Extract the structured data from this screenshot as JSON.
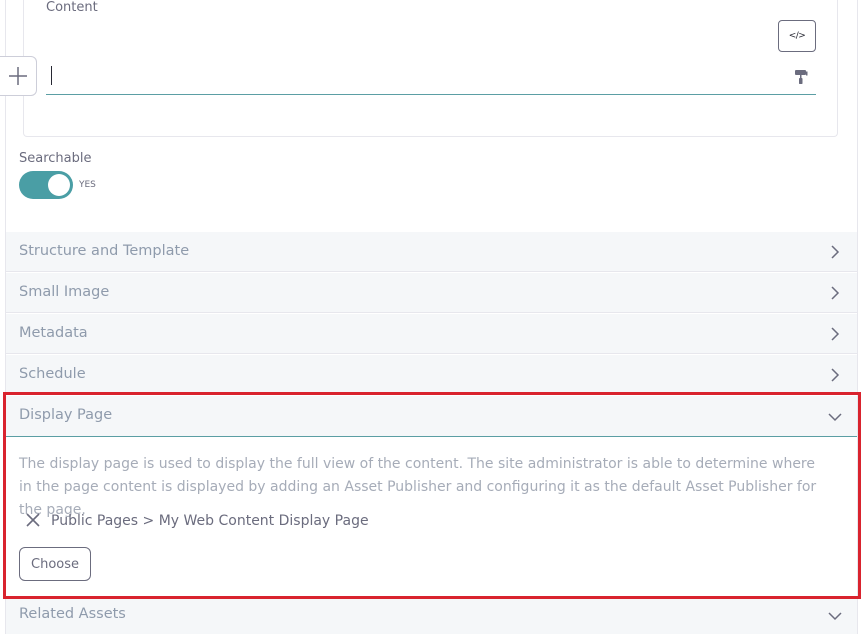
{
  "content_field": {
    "label": "Content",
    "source_button": "</>",
    "add_icon": "plus-icon",
    "paint_icon": "paint-roller-icon"
  },
  "searchable": {
    "label": "Searchable",
    "toggle_text": "YES",
    "enabled": true
  },
  "panels": {
    "structure": "Structure and Template",
    "small_image": "Small Image",
    "metadata": "Metadata",
    "schedule": "Schedule",
    "related_assets": "Related Assets"
  },
  "display_page": {
    "title": "Display Page",
    "description": "The display page is used to display the full view of the content. The site administrator is able to determine where in the page content is displayed by adding an Asset Publisher and configuring it as the default Asset Publisher for the page.",
    "selected_page": "Public Pages > My Web Content Display Page",
    "choose_label": "Choose"
  },
  "colors": {
    "accent": "#4a9ea5",
    "highlight": "#d9232e",
    "panel_bg": "#f5f7f9"
  }
}
